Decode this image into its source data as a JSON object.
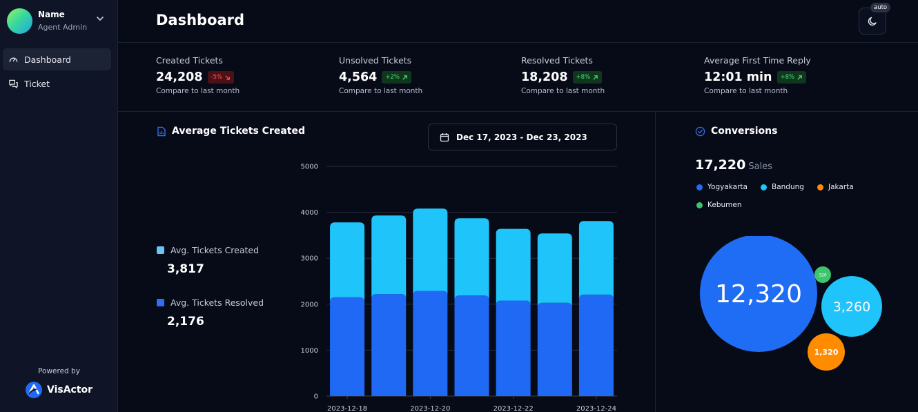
{
  "user": {
    "name": "Name",
    "role": "Agent Admin"
  },
  "nav": [
    {
      "label": "Dashboard",
      "icon": "gauge-icon",
      "active": true
    },
    {
      "label": "Ticket",
      "icon": "chat-icon",
      "active": false
    }
  ],
  "footer": {
    "powered_by": "Powered by",
    "brand": "VisActor"
  },
  "header": {
    "title": "Dashboard",
    "theme_badge": "auto",
    "theme_icon": "moon-icon"
  },
  "stats": [
    {
      "label": "Created Tickets",
      "value": "24,208",
      "change": "-5%",
      "direction": "down",
      "compare": "Compare to last month"
    },
    {
      "label": "Unsolved Tickets",
      "value": "4,564",
      "change": "+2%",
      "direction": "up",
      "compare": "Compare to last month"
    },
    {
      "label": "Resolved Tickets",
      "value": "18,208",
      "change": "+8%",
      "direction": "up",
      "compare": "Compare to last month"
    },
    {
      "label": "Average First Time Reply",
      "value": "12:01 min",
      "change": "+8%",
      "direction": "up",
      "compare": "Compare to last month"
    }
  ],
  "tickets_panel": {
    "title": "Average Tickets Created",
    "date_range": "Dec 17, 2023 - Dec 23, 2023",
    "legend": [
      {
        "label": "Avg. Tickets Created",
        "value": "3,817",
        "color": "#6ec3f5"
      },
      {
        "label": "Avg. Tickets Resolved",
        "value": "2,176",
        "color": "#2f6ff0"
      }
    ]
  },
  "chart_data": {
    "type": "bar",
    "stacked": true,
    "categories": [
      "2023-12-18",
      "2023-12-19",
      "2023-12-20",
      "2023-12-21",
      "2023-12-22",
      "2023-12-23",
      "2023-12-24"
    ],
    "x_tick_labels": [
      "2023-12-18",
      "2023-12-20",
      "2023-12-22",
      "2023-12-24"
    ],
    "series": [
      {
        "values": [
          2150,
          2220,
          2290,
          2190,
          2080,
          2030,
          2210
        ],
        "color": "#1f69f5"
      },
      {
        "values": [
          1630,
          1710,
          1790,
          1680,
          1560,
          1510,
          1600
        ],
        "color": "#1fc4fa"
      }
    ],
    "yticks": [
      0,
      1000,
      2000,
      3000,
      4000,
      5000
    ],
    "ylim": [
      0,
      5000
    ],
    "grid": true
  },
  "conversions": {
    "title": "Conversions",
    "total": "17,220",
    "unit": "Sales",
    "legend": [
      {
        "label": "Yogyakarta",
        "color": "#1f6df5"
      },
      {
        "label": "Bandung",
        "color": "#1fc4fa"
      },
      {
        "label": "Jakarta",
        "color": "#ff8c00"
      },
      {
        "label": "Kebumen",
        "color": "#3ec46d"
      }
    ],
    "bubbles": [
      {
        "label": "Yogyakarta",
        "value": 12320,
        "text": "12,320",
        "color": "#1f6df5"
      },
      {
        "label": "Bandung",
        "value": 3260,
        "text": "3,260",
        "color": "#1fc4fa"
      },
      {
        "label": "Jakarta",
        "value": 1320,
        "text": "1,320",
        "color": "#ff8c00"
      },
      {
        "label": "Kebumen",
        "value": 320,
        "text": "320",
        "color": "#3ec46d"
      }
    ]
  }
}
